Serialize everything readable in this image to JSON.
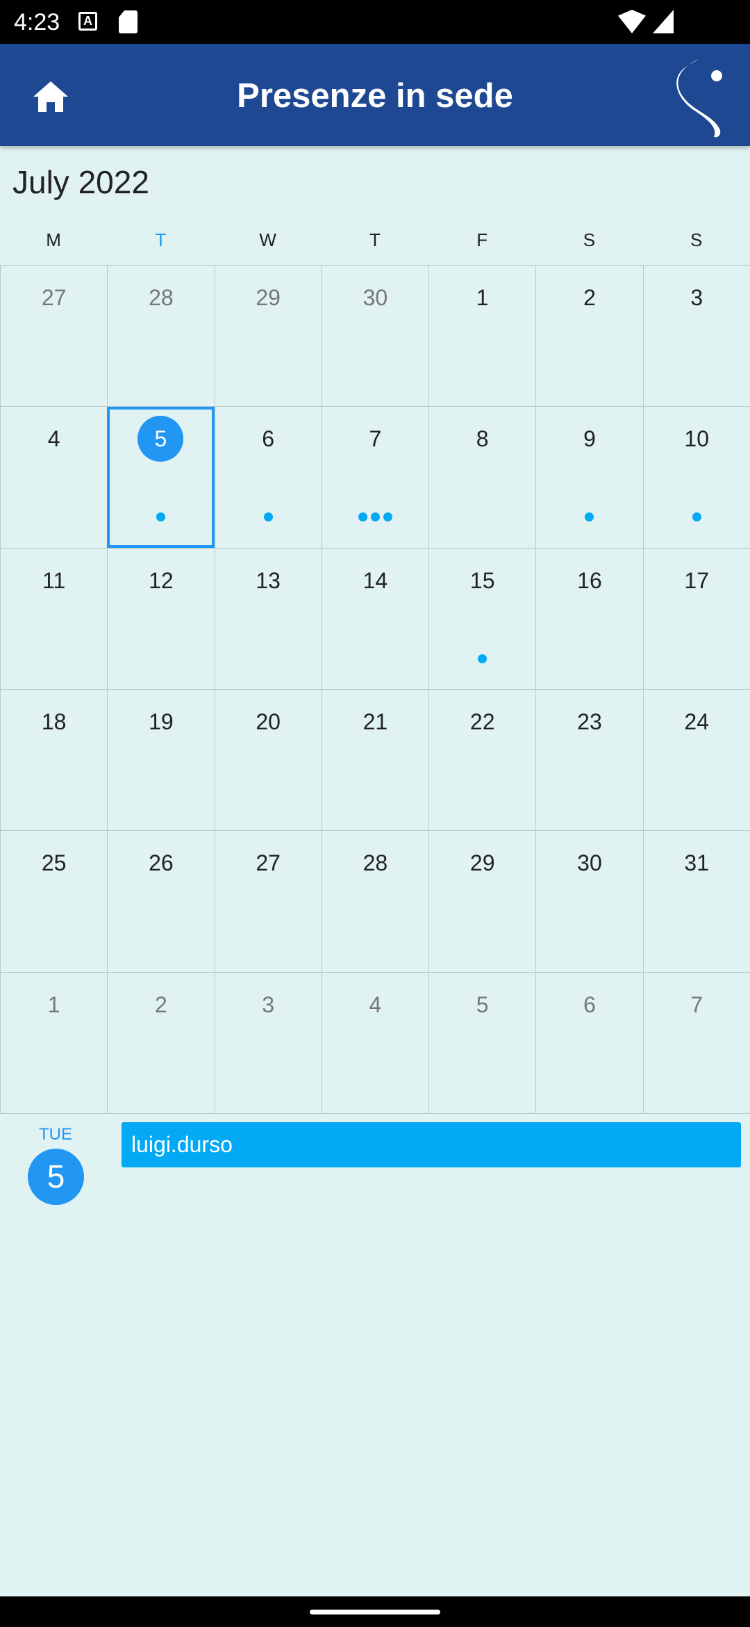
{
  "status_bar": {
    "time": "4:23",
    "icons": [
      "a-icon",
      "sd-card-icon",
      "wifi-icon",
      "signal-icon"
    ]
  },
  "app_bar": {
    "title": "Presenze in sede",
    "home_icon": "home-icon",
    "logo": "brand-logo-icon",
    "color": "#1e4891"
  },
  "calendar": {
    "month_label": "July 2022",
    "weekdays": [
      "M",
      "T",
      "W",
      "T",
      "F",
      "S",
      "S"
    ],
    "today_weekday_index": 1,
    "selected_day": "5",
    "accent_color": "#2196f3",
    "weeks": [
      [
        {
          "d": "27",
          "other": true,
          "dots": 0
        },
        {
          "d": "28",
          "other": true,
          "dots": 0
        },
        {
          "d": "29",
          "other": true,
          "dots": 0
        },
        {
          "d": "30",
          "other": true,
          "dots": 0
        },
        {
          "d": "1",
          "dots": 0
        },
        {
          "d": "2",
          "dots": 0
        },
        {
          "d": "3",
          "dots": 0
        }
      ],
      [
        {
          "d": "4",
          "dots": 0
        },
        {
          "d": "5",
          "dots": 1,
          "selected": true
        },
        {
          "d": "6",
          "dots": 1
        },
        {
          "d": "7",
          "dots": 3
        },
        {
          "d": "8",
          "dots": 0
        },
        {
          "d": "9",
          "dots": 1
        },
        {
          "d": "10",
          "dots": 1
        }
      ],
      [
        {
          "d": "11",
          "dots": 0
        },
        {
          "d": "12",
          "dots": 0
        },
        {
          "d": "13",
          "dots": 0
        },
        {
          "d": "14",
          "dots": 0
        },
        {
          "d": "15",
          "dots": 1
        },
        {
          "d": "16",
          "dots": 0
        },
        {
          "d": "17",
          "dots": 0
        }
      ],
      [
        {
          "d": "18",
          "dots": 0
        },
        {
          "d": "19",
          "dots": 0
        },
        {
          "d": "20",
          "dots": 0
        },
        {
          "d": "21",
          "dots": 0
        },
        {
          "d": "22",
          "dots": 0
        },
        {
          "d": "23",
          "dots": 0
        },
        {
          "d": "24",
          "dots": 0
        }
      ],
      [
        {
          "d": "25",
          "dots": 0
        },
        {
          "d": "26",
          "dots": 0
        },
        {
          "d": "27",
          "dots": 0
        },
        {
          "d": "28",
          "dots": 0
        },
        {
          "d": "29",
          "dots": 0
        },
        {
          "d": "30",
          "dots": 0
        },
        {
          "d": "31",
          "dots": 0
        }
      ],
      [
        {
          "d": "1",
          "other": true,
          "dots": 0
        },
        {
          "d": "2",
          "other": true,
          "dots": 0
        },
        {
          "d": "3",
          "other": true,
          "dots": 0
        },
        {
          "d": "4",
          "other": true,
          "dots": 0
        },
        {
          "d": "5",
          "other": true,
          "dots": 0
        },
        {
          "d": "6",
          "other": true,
          "dots": 0
        },
        {
          "d": "7",
          "other": true,
          "dots": 0
        }
      ]
    ]
  },
  "agenda": {
    "day_of_week": "TUE",
    "day_number": "5",
    "events": [
      {
        "title": "luigi.durso",
        "color": "#03a9f4"
      }
    ]
  }
}
